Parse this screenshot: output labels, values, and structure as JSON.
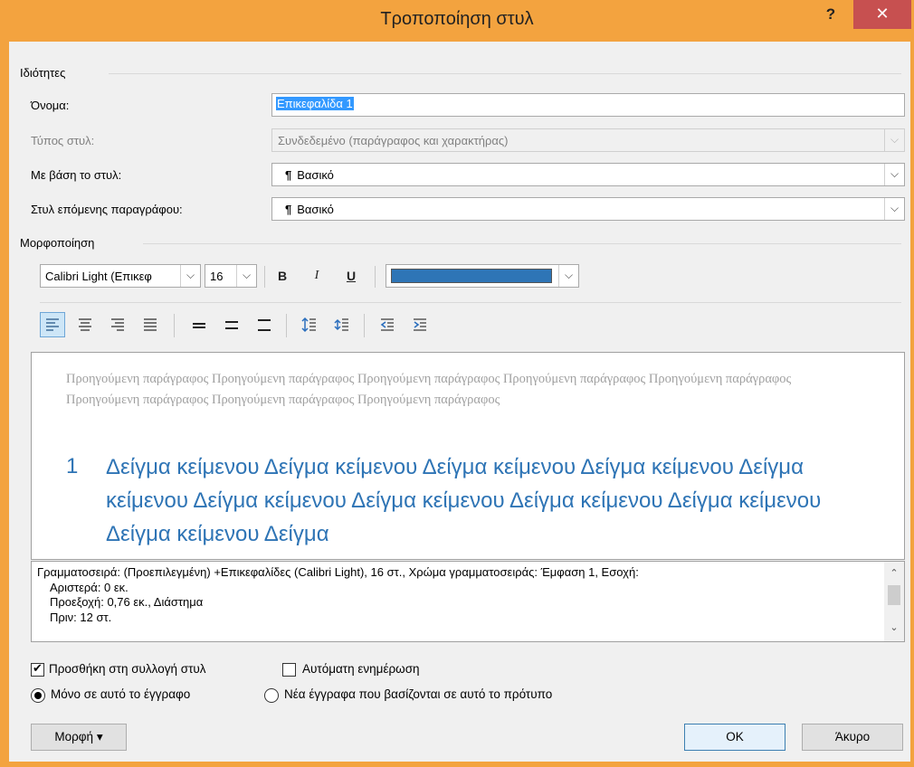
{
  "window": {
    "title": "Τροποποίηση στυλ",
    "help_label": "?",
    "close_label": "✕"
  },
  "properties": {
    "section_label": "Ιδιότητες",
    "name_label": "Όνομα:",
    "name_value": "Επικεφαλίδα 1",
    "style_type_label": "Τύπος στυλ:",
    "style_type_value": "Συνδεδεμένο (παράγραφος και χαρακτήρας)",
    "based_on_label": "Με βάση το στυλ:",
    "based_on_value": "Βασικό",
    "next_style_label": "Στυλ επόμενης παραγράφου:",
    "next_style_value": "Βασικό",
    "pilcrow": "¶"
  },
  "formatting": {
    "section_label": "Μορφοποίηση",
    "font_value": "Calibri Light (Επικεφ",
    "size_value": "16",
    "bold_label": "B",
    "italic_label": "I",
    "underline_label": "U",
    "color_value": "#2e75b6"
  },
  "paragraph_toolbar": {
    "icons": [
      "align-left-icon",
      "align-center-icon",
      "align-right-icon",
      "justify-icon",
      "single-spacing-icon",
      "one-half-spacing-icon",
      "double-spacing-icon",
      "space-before-icon",
      "space-after-icon",
      "decrease-indent-icon",
      "increase-indent-icon"
    ],
    "active": "align-left-icon"
  },
  "preview": {
    "previous_paragraph": "Προηγούμενη παράγραφος Προηγούμενη παράγραφος Προηγούμενη παράγραφος Προηγούμενη παράγραφος Προηγούμενη παράγραφος Προηγούμενη παράγραφος Προηγούμενη παράγραφος Προηγούμενη παράγραφος",
    "heading_number": "1",
    "sample_text": "Δείγμα κείμενου Δείγμα κείμενου Δείγμα κείμενου Δείγμα κείμενου Δείγμα κείμενου Δείγμα κείμενου Δείγμα κείμενου Δείγμα κείμενου Δείγμα κείμενου Δείγμα κείμενου Δείγμα"
  },
  "description": {
    "line1": "Γραμματοσειρά: (Προεπιλεγμένη) +Επικεφαλίδες (Calibri Light), 16 στ., Χρώμα γραμματοσειράς: Έμφαση 1, Εσοχή:",
    "line2": "Αριστερά:  0 εκ.",
    "line3": "Προεξοχή:  0,76 εκ., Διάστημα",
    "line4": "Πριν:  12 στ."
  },
  "options": {
    "add_to_gallery_label": "Προσθήκη στη συλλογή στυλ",
    "add_to_gallery_checked": true,
    "auto_update_label": "Αυτόματη ενημέρωση",
    "auto_update_checked": false,
    "only_this_document_label": "Μόνο σε αυτό το έγγραφο",
    "new_documents_label": "Νέα έγγραφα που βασίζονται σε αυτό το πρότυπο",
    "selected_scope": "only_this_document"
  },
  "buttons": {
    "format_label": "Μορφή ▾",
    "ok_label": "OK",
    "cancel_label": "Άκυρο"
  }
}
